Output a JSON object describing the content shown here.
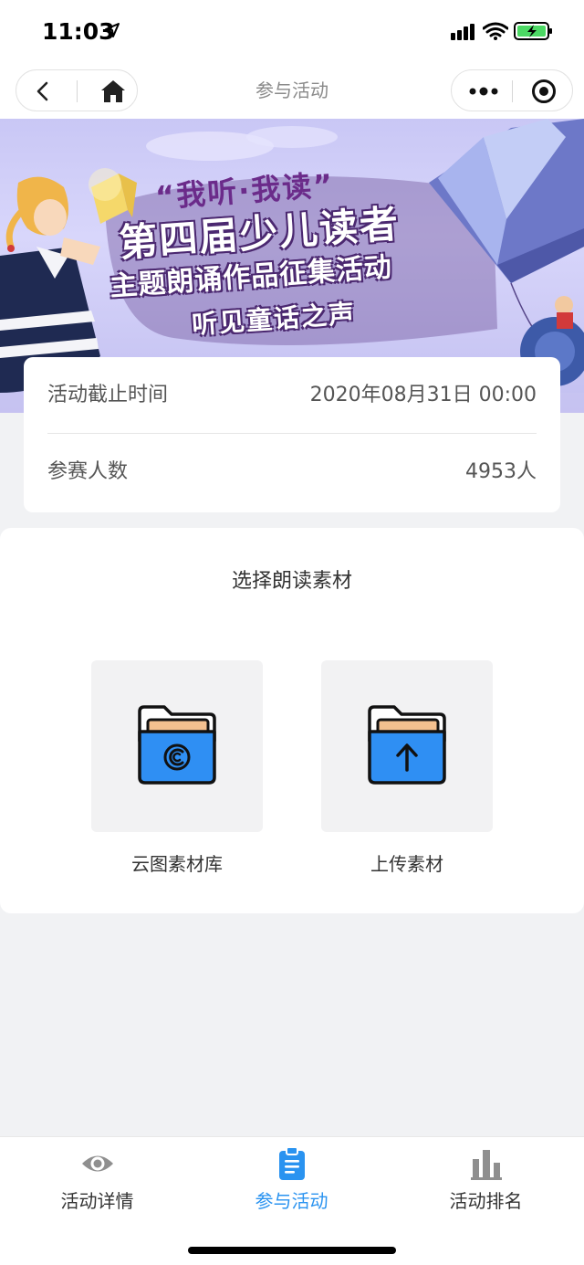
{
  "status_bar": {
    "time": "11:03",
    "icons": [
      "location-arrow-icon",
      "signal-icon",
      "wifi-icon",
      "battery-charging-icon"
    ]
  },
  "nav": {
    "title": "参与活动",
    "icons": [
      "back-icon",
      "home-icon",
      "more-icon",
      "target-icon"
    ]
  },
  "banner": {
    "quote": "“我听·我读”",
    "line1": "第四届少儿读者",
    "line2": "主题朗诵作品征集活动",
    "line3": "听见童话之声"
  },
  "info": {
    "deadline_label": "活动截止时间",
    "deadline_value": "2020年08月31日 00:00",
    "participants_label": "参赛人数",
    "participants_value": "4953人"
  },
  "material": {
    "title": "选择朗读素材",
    "options": [
      {
        "label": "云图素材库",
        "icon": "cloud-library-folder-icon"
      },
      {
        "label": "上传素材",
        "icon": "upload-folder-icon"
      }
    ]
  },
  "tabs": [
    {
      "label": "活动详情",
      "icon": "eye-icon",
      "active": false
    },
    {
      "label": "参与活动",
      "icon": "clipboard-icon",
      "active": true
    },
    {
      "label": "活动排名",
      "icon": "bar-chart-icon",
      "active": false
    }
  ],
  "colors": {
    "accent": "#2a93f0",
    "folder_blue": "#2f8ff3",
    "folder_paper": "#f3c08f",
    "banner_purple": "#4b2870"
  }
}
